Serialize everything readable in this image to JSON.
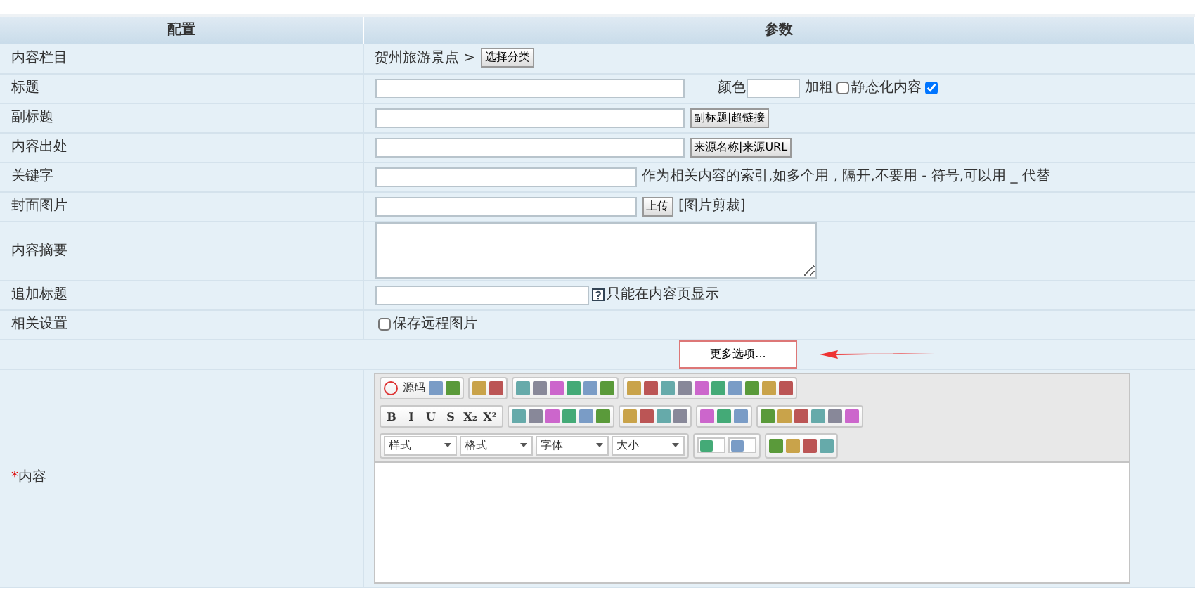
{
  "table": {
    "columns": [
      "配置",
      "参数"
    ],
    "rows": [
      {
        "label": "内容栏目",
        "kind": "category",
        "path": "贺州旅游景点 >",
        "button": "选择分类"
      },
      {
        "label": "标题",
        "kind": "title",
        "color_label": "颜色",
        "bold_label": "加粗",
        "bold_checked": false,
        "static_label": "静态化内容",
        "static_checked": true
      },
      {
        "label": "副标题",
        "kind": "input_button",
        "button": "副标题|超链接"
      },
      {
        "label": "内容出处",
        "kind": "input_button",
        "button": "来源名称|来源URL"
      },
      {
        "label": "关键字",
        "kind": "keywords",
        "hint": "作为相关内容的索引,如多个用 , 隔开,不要用 - 符号,可以用 _ 代替"
      },
      {
        "label": "封面图片",
        "kind": "upload",
        "button": "上传",
        "link": "[图片剪裁]"
      },
      {
        "label": "内容摘要",
        "kind": "textarea"
      },
      {
        "label": "追加标题",
        "kind": "append",
        "note": "只能在内容页显示"
      },
      {
        "label": "相关设置",
        "kind": "checkbox",
        "text": "保存远程图片",
        "checked": false
      },
      {
        "kind": "more",
        "button": "更多选项..."
      },
      {
        "label": "内容",
        "required": true,
        "required_mark": "*",
        "kind": "editor"
      }
    ]
  },
  "editor": {
    "toolbar": [
      [
        [
          {
            "kind": "source",
            "label": "源码"
          },
          {
            "kind": "icon"
          },
          {
            "kind": "icon"
          }
        ],
        [
          {
            "kind": "icon"
          },
          {
            "kind": "icon"
          }
        ],
        [
          {
            "kind": "icon"
          },
          {
            "kind": "icon"
          },
          {
            "kind": "icon"
          },
          {
            "kind": "icon"
          },
          {
            "kind": "icon"
          },
          {
            "kind": "icon"
          }
        ],
        [
          {
            "kind": "icon"
          },
          {
            "kind": "icon"
          },
          {
            "kind": "icon"
          },
          {
            "kind": "icon"
          },
          {
            "kind": "icon"
          },
          {
            "kind": "icon"
          },
          {
            "kind": "icon"
          },
          {
            "kind": "icon"
          },
          {
            "kind": "icon"
          },
          {
            "kind": "icon"
          }
        ]
      ],
      [
        [
          {
            "kind": "text",
            "label": "B"
          },
          {
            "kind": "text",
            "label": "I"
          },
          {
            "kind": "text",
            "label": "U"
          },
          {
            "kind": "text",
            "label": "S"
          },
          {
            "kind": "text",
            "label": "X₂"
          },
          {
            "kind": "text",
            "label": "X²"
          }
        ],
        [
          {
            "kind": "icon"
          },
          {
            "kind": "icon"
          },
          {
            "kind": "icon"
          },
          {
            "kind": "icon"
          },
          {
            "kind": "icon"
          },
          {
            "kind": "icon"
          }
        ],
        [
          {
            "kind": "icon"
          },
          {
            "kind": "icon"
          },
          {
            "kind": "icon"
          },
          {
            "kind": "icon"
          }
        ],
        [
          {
            "kind": "icon"
          },
          {
            "kind": "icon"
          },
          {
            "kind": "icon"
          }
        ],
        [
          {
            "kind": "icon"
          },
          {
            "kind": "icon"
          },
          {
            "kind": "icon"
          },
          {
            "kind": "icon"
          },
          {
            "kind": "icon"
          },
          {
            "kind": "icon"
          }
        ]
      ],
      [
        [
          {
            "kind": "select",
            "label": "样式"
          },
          {
            "kind": "select",
            "label": "格式"
          },
          {
            "kind": "select",
            "label": "字体"
          },
          {
            "kind": "select",
            "label": "大小"
          }
        ],
        [
          {
            "kind": "colorpick"
          },
          {
            "kind": "colorpick"
          }
        ],
        [
          {
            "kind": "icon"
          },
          {
            "kind": "icon"
          },
          {
            "kind": "icon"
          },
          {
            "kind": "icon"
          }
        ]
      ]
    ]
  }
}
